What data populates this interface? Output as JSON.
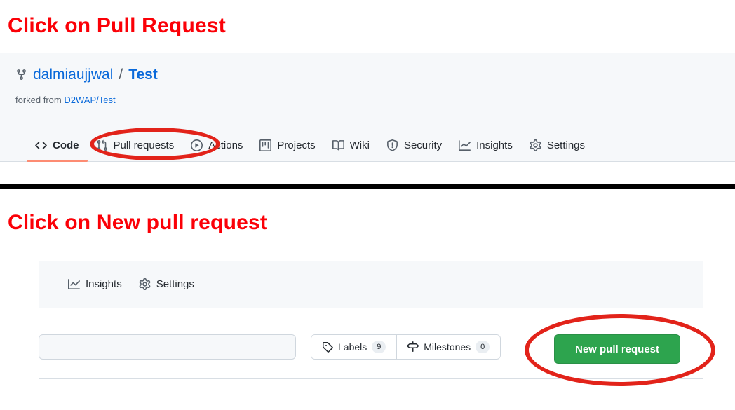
{
  "annotations": {
    "step1": "Click on Pull Request",
    "step2": "Click on New pull request",
    "highlight_color": "#e2231a",
    "heading_color": "#fb0007"
  },
  "repo_header": {
    "fork_icon": "repo-forked-icon",
    "owner": "dalmiaujjwal",
    "separator": "/",
    "name": "Test",
    "forked_from_prefix": "forked from",
    "forked_from_source": "D2WAP/Test"
  },
  "repo_nav": {
    "tabs": [
      {
        "label": "Code",
        "icon": "code-icon",
        "active": true
      },
      {
        "label": "Pull requests",
        "icon": "git-pull-request-icon",
        "active": false
      },
      {
        "label": "Actions",
        "icon": "play-circle-icon",
        "active": false
      },
      {
        "label": "Projects",
        "icon": "project-board-icon",
        "active": false
      },
      {
        "label": "Wiki",
        "icon": "book-icon",
        "active": false
      },
      {
        "label": "Security",
        "icon": "shield-icon",
        "active": false
      },
      {
        "label": "Insights",
        "icon": "graph-icon",
        "active": false
      },
      {
        "label": "Settings",
        "icon": "gear-icon",
        "active": false
      }
    ],
    "active_underline_color": "#fd8c73"
  },
  "pr_page": {
    "subnav_tabs": [
      {
        "label": "Insights",
        "icon": "graph-icon"
      },
      {
        "label": "Settings",
        "icon": "gear-icon"
      }
    ],
    "search": {
      "value": "",
      "placeholder": ""
    },
    "filters": [
      {
        "label": "Labels",
        "icon": "tag-icon",
        "count": "9"
      },
      {
        "label": "Milestones",
        "icon": "milestone-icon",
        "count": "0"
      }
    ],
    "new_pr_button": {
      "label": "New pull request",
      "color": "#2da44e"
    }
  }
}
